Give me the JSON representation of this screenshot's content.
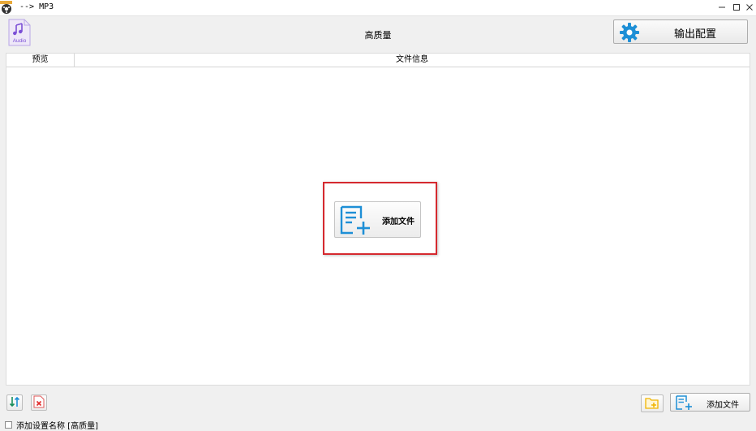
{
  "window": {
    "title": "--> MP3",
    "app_icon": "film-reel-app-icon",
    "controls": [
      "minimize-icon",
      "maximize-icon",
      "close-icon"
    ]
  },
  "toolbar": {
    "format_icon": "audio-file-icon",
    "format_icon_text": "Audio",
    "preset_name": "高质量",
    "output_config_label": "输出配置",
    "output_config_icon": "gear-icon"
  },
  "file_list": {
    "columns": [
      "预览",
      "文件信息"
    ],
    "rows": [],
    "center_add_label": "添加文件",
    "center_add_icon": "add-file-icon"
  },
  "bottom": {
    "left_buttons": [
      "sort-icon",
      "remove-icon"
    ],
    "add_folder_icon": "add-folder-icon",
    "add_file_label": "添加文件",
    "checkbox_label": "添加设置名称 [高质量]",
    "checkbox_checked": false
  },
  "colors": {
    "highlight": "#d5292f",
    "accent_blue": "#1e8fd6",
    "audio_purple": "#7b4fd6",
    "folder_yellow": "#f0b400"
  }
}
